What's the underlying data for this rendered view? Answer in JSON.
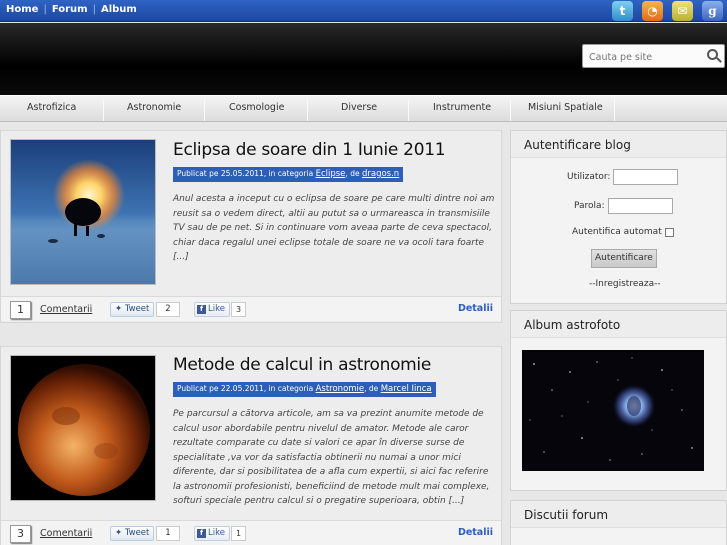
{
  "topnav": {
    "home": "Home",
    "forum": "Forum",
    "album": "Album"
  },
  "social": [
    {
      "icon": "twitter-icon",
      "glyph": "t"
    },
    {
      "icon": "rss-icon",
      "glyph": "◔"
    },
    {
      "icon": "email-icon",
      "glyph": "✉"
    },
    {
      "icon": "google-icon",
      "glyph": "g"
    }
  ],
  "search": {
    "placeholder": "Cauta pe site"
  },
  "menu": [
    "Astrofizica",
    "Astronomie",
    "Cosmologie",
    "Diverse",
    "Instrumente",
    "Misiuni Spatiale"
  ],
  "posts": [
    {
      "title": "Eclipsa de soare din 1 Iunie 2011",
      "meta_prefix": "Publicat pe 25.05.2011, in categoria",
      "category": "Eclipse",
      "meta_by": ", de",
      "author": "dragos.n",
      "excerpt": "Anul acesta a inceput cu o eclipsa de soare pe care multi dintre noi am reusit sa o vedem direct, altii au putut sa o urmareasca in transmisiile TV sau de pe net. Si in continuare vom aveaa parte de ceva spectacol, chiar daca regalul unei eclipse totale de soare ne va ocoli tara foarte [...]",
      "comment_count": "1",
      "comments_label": "Comentarii",
      "tweet_label": "Tweet",
      "tweet_count": "2",
      "like_label": "Like",
      "like_count": "3",
      "details_label": "Detalii"
    },
    {
      "title": "Metode de calcul in astronomie",
      "meta_prefix": "Publicat pe 22.05.2011, in categoria",
      "category": "Astronomie",
      "meta_by": ", de",
      "author": "Marcel Iinca",
      "excerpt": "Pe parcursul a cătorva articole, am sa va prezint anumite metode de calcul usor abordabile pentru nivelul de amator. Metode ale caror rezultate comparate cu date si valori ce apar în diverse surse de specialitate ,va vor da satisfactia obtinerii nu numai a unor mici diferente, dar si posibilitatea de a afla cum expertii, si aici fac referire la astronomii profesionisti, beneficiind de metode mult mai complexe, softuri speciale pentru calcul si o pregatire superioara, obtin [...]",
      "comment_count": "3",
      "comments_label": "Comentarii",
      "tweet_label": "Tweet",
      "tweet_count": "1",
      "like_label": "Like",
      "like_count": "1",
      "details_label": "Detalii"
    }
  ],
  "login": {
    "title": "Autentificare blog",
    "user_label": "Utilizator:",
    "pass_label": "Parola:",
    "remember_label": "Autentifica automat",
    "button": "Autentificare",
    "register": "--Inregistreaza--"
  },
  "album": {
    "title": "Album astrofoto"
  },
  "forum": {
    "title": "Discutii forum"
  },
  "colors": {
    "accent": "#2d5eb8",
    "topbar": "#1d48a0",
    "header": "#000000"
  }
}
